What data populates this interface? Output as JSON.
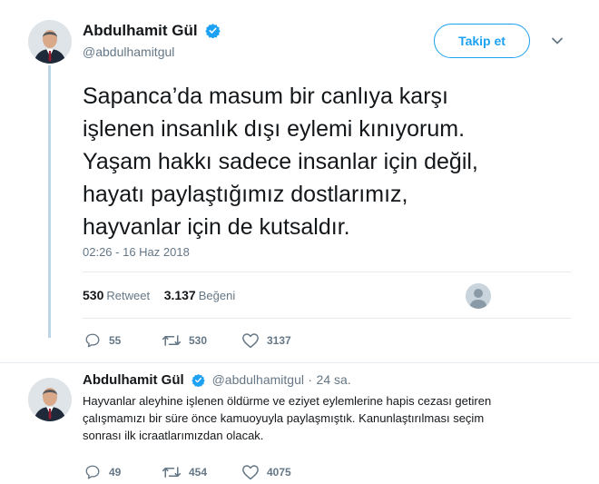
{
  "main_tweet": {
    "author_name": "Abdulhamit Gül",
    "handle": "@abdulhamitgul",
    "follow_label": "Takip et",
    "text_lines": [
      "Sapanca’da masum bir canlıya karşı",
      "işlenen insanlık dışı eylemi kınıyorum.",
      "Yaşam hakkı sadece insanlar için değil,",
      "hayatı paylaştığımız dostlarımız,",
      "hayvanlar için de kutsaldır."
    ],
    "timestamp": "02:26 - 16 Haz 2018",
    "retweet_count": "530",
    "retweet_label": "Retweet",
    "like_count": "3.137",
    "like_label": "Beğeni",
    "actions": {
      "replies": "55",
      "retweets": "530",
      "likes": "3137"
    }
  },
  "reply_tweet": {
    "author_name": "Abdulhamit Gül",
    "handle": "@abdulhamitgul",
    "separator": "·",
    "time_ago": "24 sa.",
    "text_lines": [
      "Hayvanlar aleyhine işlenen öldürme ve eziyet eylemlerine hapis cezası getiren",
      "çalışmamızı bir süre önce kamuoyuyla paylaşmıştık. Kanunlaştırılması seçim",
      "sonrası ilk icraatlarımızdan olacak."
    ],
    "actions": {
      "replies": "49",
      "retweets": "454",
      "likes": "4075"
    }
  },
  "colors": {
    "accent": "#1da1f2",
    "muted": "#657786",
    "text": "#14171a",
    "divider": "#e6ecf0",
    "thread_line": "#bcd6e6"
  },
  "icons": [
    "verified-icon",
    "chevron-down-icon",
    "reply-icon",
    "retweet-icon",
    "like-icon",
    "avatar",
    "liker-avatar"
  ]
}
